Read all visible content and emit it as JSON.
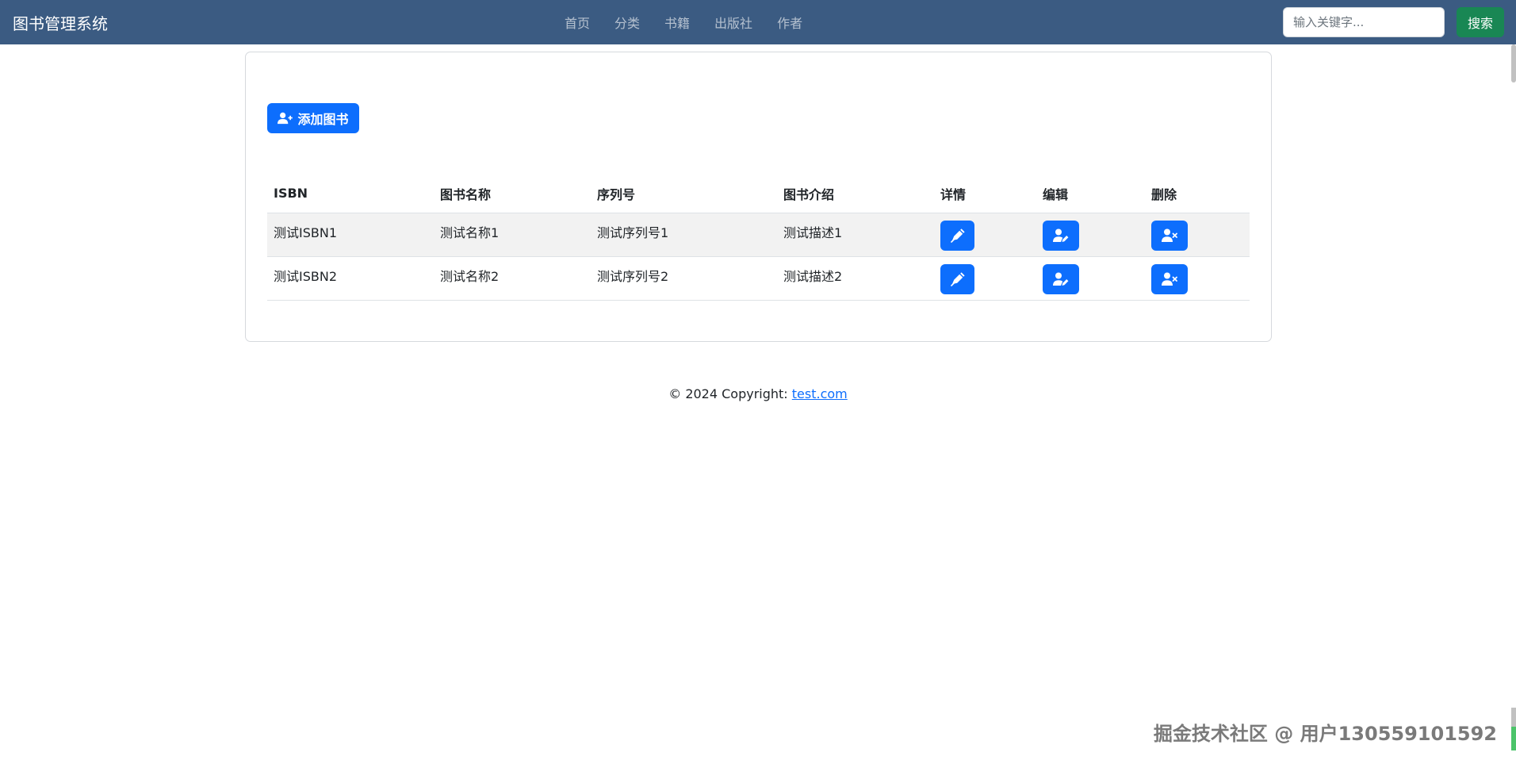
{
  "app": {
    "brand": "图书管理系统"
  },
  "nav": {
    "items": [
      {
        "label": "首页"
      },
      {
        "label": "分类"
      },
      {
        "label": "书籍"
      },
      {
        "label": "出版社"
      },
      {
        "label": "作者"
      }
    ]
  },
  "search": {
    "placeholder": "输入关键字...",
    "value": "",
    "button_label": "搜索"
  },
  "main": {
    "add_button_label": "添加图书",
    "add_button_icon": "user-plus-icon",
    "table": {
      "headers": [
        "ISBN",
        "图书名称",
        "序列号",
        "图书介绍",
        "详情",
        "编辑",
        "删除"
      ],
      "rows": [
        {
          "isbn": "测试ISBN1",
          "name": "测试名称1",
          "serial": "测试序列号1",
          "description": "测试描述1"
        },
        {
          "isbn": "测试ISBN2",
          "name": "测试名称2",
          "serial": "测试序列号2",
          "description": "测试描述2"
        }
      ],
      "row_action_icons": {
        "detail": "pen-nib-icon",
        "edit": "user-pen-icon",
        "delete": "user-xmark-icon"
      }
    }
  },
  "footer": {
    "copyright": "© 2024 Copyright: ",
    "link_text": "test.com"
  },
  "watermark": "掘金技术社区 @ 用户130559101592",
  "colors": {
    "navbar": "#3b5b82",
    "primary": "#0d6efd",
    "success": "#198754",
    "row_stripe": "#f2f2f2"
  }
}
